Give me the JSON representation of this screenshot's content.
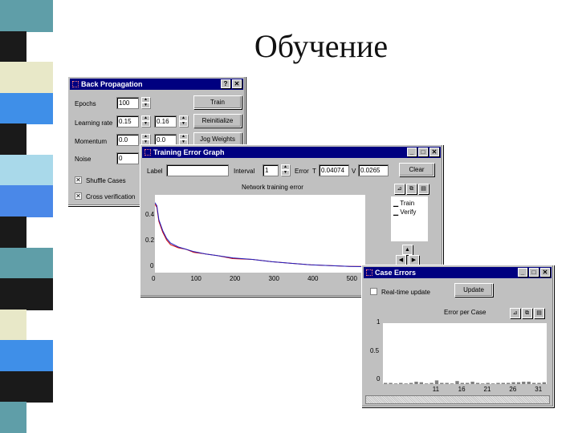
{
  "slide": {
    "title": "Обучение"
  },
  "stripe_colors": [
    "#5f9ea8",
    "#1a1a1a",
    "#e8e8c8",
    "#3f8fe8",
    "#1a1a1a",
    "#a9d9ea",
    "#4a88e8",
    "#1a1a1a",
    "#5f9ea8",
    "#1a1a1a",
    "#e8e8c8",
    "#3f8fe8",
    "#1a1a1a",
    "#5f9ea8"
  ],
  "bp": {
    "title": "Back Propagation",
    "epochs_label": "Epochs",
    "epochs_value": "100",
    "lr_label": "Learning rate",
    "lr_value1": "0.15",
    "lr_value2": "0.16",
    "momentum_label": "Momentum",
    "momentum_value1": "0.0",
    "momentum_value2": "0.0",
    "noise_label": "Noise",
    "noise_value": "0",
    "train_btn": "Train",
    "reinit_btn": "Reinitialize",
    "jog_btn": "Jog Weights",
    "shuffle_label": "Shuffle Cases",
    "crossver_label": "Cross verification"
  },
  "teg": {
    "title": "Training Error Graph",
    "label_label": "Label",
    "label_value": "",
    "interval_label": "Interval",
    "interval_value": "1",
    "error_label": "Error",
    "t_label": "T",
    "t_value": "0.04074",
    "v_label": "V",
    "v_value": "0.0265",
    "clear_btn": "Clear",
    "chart_title": "Network training error",
    "legend_train": "Train",
    "legend_verify": "Verify",
    "ytick_04": "0.4",
    "ytick_02": "0.2",
    "ytick_0": "0",
    "xticks": [
      "0",
      "100",
      "200",
      "300",
      "400",
      "500"
    ]
  },
  "ce": {
    "title": "Case Errors",
    "realtime_label": "Real-time update",
    "update_btn": "Update",
    "chart_title": "Error per Case",
    "ytick_1": "1",
    "ytick_05": "0.5",
    "ytick_0": "0",
    "xticks": [
      "11",
      "16",
      "21",
      "26",
      "31"
    ]
  },
  "chart_data": [
    {
      "type": "line",
      "title": "Network training error",
      "xlabel": "",
      "ylabel": "",
      "xlim": [
        0,
        540
      ],
      "ylim": [
        0,
        0.5
      ],
      "series": [
        {
          "name": "Train",
          "x": [
            0,
            5,
            10,
            20,
            30,
            40,
            60,
            80,
            100,
            130,
            160,
            200,
            250,
            300,
            350,
            400,
            450,
            500,
            540
          ],
          "y": [
            0.44,
            0.42,
            0.33,
            0.26,
            0.21,
            0.18,
            0.16,
            0.15,
            0.13,
            0.12,
            0.11,
            0.09,
            0.085,
            0.07,
            0.06,
            0.05,
            0.045,
            0.04,
            0.04
          ]
        },
        {
          "name": "Verify",
          "x": [
            0,
            5,
            10,
            20,
            30,
            40,
            60,
            80,
            100,
            130,
            160,
            200,
            250,
            300,
            350,
            400,
            450,
            500,
            540
          ],
          "y": [
            0.45,
            0.43,
            0.34,
            0.27,
            0.22,
            0.19,
            0.165,
            0.15,
            0.135,
            0.12,
            0.11,
            0.095,
            0.085,
            0.07,
            0.06,
            0.05,
            0.045,
            0.04,
            0.038
          ]
        }
      ]
    },
    {
      "type": "bar",
      "title": "Error per Case",
      "xlabel": "",
      "ylabel": "",
      "ylim": [
        0,
        1
      ],
      "categories": [
        "1",
        "2",
        "3",
        "4",
        "5",
        "6",
        "7",
        "8",
        "9",
        "10",
        "11",
        "12",
        "13",
        "14",
        "15",
        "16",
        "17",
        "18",
        "19",
        "20",
        "21",
        "22",
        "23",
        "24",
        "25",
        "26",
        "27",
        "28",
        "29",
        "30",
        "31",
        "32"
      ],
      "values": [
        0.02,
        0.02,
        0.01,
        0.02,
        0.01,
        0.02,
        0.04,
        0.03,
        0.01,
        0.02,
        0.06,
        0.02,
        0.02,
        0.01,
        0.05,
        0.02,
        0.02,
        0.04,
        0.02,
        0.01,
        0.02,
        0.01,
        0.02,
        0.02,
        0.02,
        0.03,
        0.03,
        0.04,
        0.04,
        0.02,
        0.02,
        0.03
      ]
    }
  ]
}
